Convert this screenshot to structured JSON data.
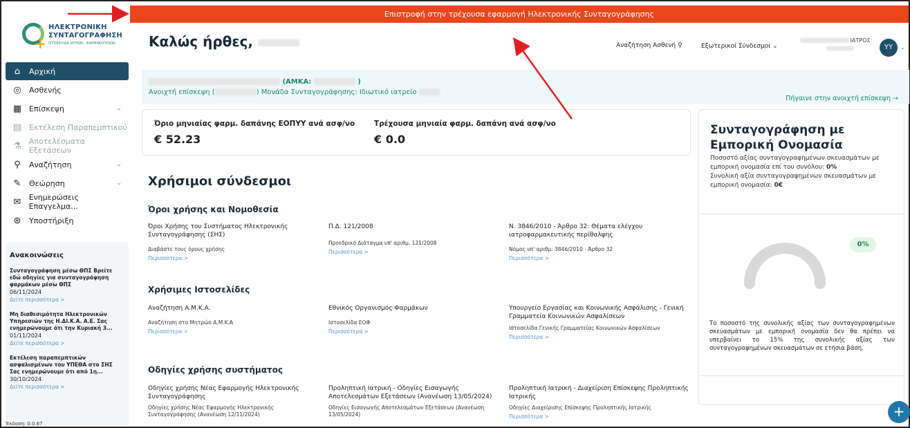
{
  "banner": {
    "text": "Επιστροφή στην τρέχουσα εφαρμογή Ηλεκτρονικής Συνταγογράφησης"
  },
  "logo": {
    "line1": "ΗΛΕΚΤΡΟΝΙΚΗ",
    "line2": "ΣΥΝΤΑΓΟΓΡΑΦΗΣΗ",
    "line3": "ΙΣΤΟΣΕΛΙΔΑ ΙΑΤΡΩΝ - ΦΑΡΜΑΚΟΠΟΙΩΝ"
  },
  "sidebar": {
    "items": [
      {
        "label": "Αρχική",
        "icon": "home-icon"
      },
      {
        "label": "Ασθενής",
        "icon": "user-icon"
      },
      {
        "label": "Επίσκεψη",
        "icon": "calendar-icon"
      },
      {
        "label": "Εκτέλεση Παραπεμπτικού",
        "icon": "document-icon"
      },
      {
        "label": "Αποτελέσματα Εξετάσεων",
        "icon": "flask-icon"
      },
      {
        "label": "Αναζήτηση",
        "icon": "search-icon"
      },
      {
        "label": "Θεώρηση",
        "icon": "pen-icon"
      },
      {
        "label": "Ενημερώσεις Επαγγελμα...",
        "icon": "mail-icon"
      },
      {
        "label": "Υποστήριξη",
        "icon": "support-icon"
      }
    ]
  },
  "announcements": {
    "title": "Ανακοινώσεις",
    "items": [
      {
        "head": "Συνταγογράφηση μέσω ΘΠΣ Βρείτε εδώ οδηγίες για συνταγογράφηση φαρμάκων μέσω ΘΠΣ",
        "date": "06/11/2024",
        "more": "Δείτε περισσότερα >"
      },
      {
        "head": "Μη διαθεσιμότητα Ηλεκτρονικών Υπηρεσιών της Η.ΔΙ.Κ.Α. Α.Ε. Σας ενημερώνουμε ότι την Κυριακή 3...",
        "date": "01/11/2024",
        "more": "Δείτε περισσότερα >"
      },
      {
        "head": "Εκτέλεση παραπεμπτικών ασφαλισμένων του ΥΠΕΘΑ στο ΣΗΣ Σας ενημερώνουμε ότι από 1η...",
        "date": "30/10/2024",
        "more": "Δείτε περισσότερα >"
      }
    ],
    "version": "Έκδοση: 0.0.67"
  },
  "header": {
    "greeting": "Καλώς ήρθες,",
    "search": "Αναζήτηση Ασθενή",
    "links": "Εξωτερικοί Σύνδεσμοι",
    "user_role": "ΙΑΤΡΟΣ",
    "avatar": "YY"
  },
  "patient": {
    "amka_label": "(ΑΜΚΑ:",
    "amka_close": ")",
    "visit_prefix": "Ανοιχτή επίσκεψη (",
    "visit_suffix": ")  Μονάδα Συνταγογράφησης: Ιδιωτικό ιατρείο",
    "go_link": "Πήγαινε στην ανοιχτή επίσκεψη"
  },
  "limits": {
    "limit_label": "Όριο μηνιαίας φαρμ. δαπάνης ΕΟΠΥΥ ανά ασφ/νο",
    "limit_value": "€ 52.23",
    "current_label": "Τρέχουσα μηνιαία φαρμ. δαπάνη ανά ασφ/νο",
    "current_value": "€ 0.0"
  },
  "useful": {
    "title": "Χρήσιμοι σύνδεσμοι",
    "sections": [
      {
        "title": "Όροι χρήσης και Νομοθεσία",
        "cells": [
          {
            "title": "Όροι Χρήσης του Συστήματος Ηλεκτρονικής Συνταγογράφησης (ΣΗΣ)",
            "sub": "Διαβάστε τους όρους χρήσης",
            "more": "Περισσότερα >"
          },
          {
            "title": "Π.Δ. 121/2008",
            "sub": "Προεδρικό Διάταγμα υπ' αριθμ. 121/2008",
            "more": "Περισσότερα >"
          },
          {
            "title": "Ν. 3846/2010 - Άρθρο 32: Θέματα ελέγχου ιατροφαρμακευτικής περίθαλψης",
            "sub": "Νόμος υπ' αριθμ. 3846/2010 - Άρθρο 32",
            "more": "Περισσότερα >"
          }
        ]
      },
      {
        "title": "Χρήσιμες Ιστοσελίδες",
        "cells": [
          {
            "title": "Αναζήτηση Α.Μ.Κ.Α.",
            "sub": "Αναζήτηση στο Μητρώο Α.Μ.Κ.Α",
            "more": "Περισσότερα >"
          },
          {
            "title": "Εθνικός Οργανισμός Φαρμάκων",
            "sub": "Ιστοσελίδα ΕΟΦ",
            "more": "Περισσότερα >"
          },
          {
            "title": "Υπουργείο Εργασίας και Κοινωνικής Ασφάλισης - Γενική Γραμματεία Κοινωνικών Ασφαλίσεων",
            "sub": "Ιστοσελίδα Γενικής Γραμματείας Κοινωνικών Ασφαλίσεων",
            "more": "Περισσότερα >"
          }
        ]
      },
      {
        "title": "Οδηγίες χρήσης συστήματος",
        "cells": [
          {
            "title": "Οδηγίες χρήσης Νέας Εφαρμογής Ηλεκτρονικής Συνταγογράφησης",
            "sub": "Οδηγίες χρήσης Νέας Εφαρμογής Ηλεκτρονικής Συνταγογράφησης (Ανανέωση 12/11/2024)",
            "more": ""
          },
          {
            "title": "Προληπτική Ιατρική - Οδηγίες Εισαγωγής Αποτελεσμάτων Εξετάσεων (Ανανέωση 13/05/2024)",
            "sub": "Οδηγίες Εισαγωγής Αποτελεσμάτων Εξετάσεων (Ανανέωση 13/05/2024)",
            "more": ""
          },
          {
            "title": "Προληπτική Ιατρική - Διαχείριση Επίσκεψης Προληπτικής Ιατρικής",
            "sub": "Οδηγίες Διαχείρισης Επίσκεψης Προληπτικής Ιατρικής",
            "more": "Περισσότερα >"
          }
        ]
      }
    ]
  },
  "commercial": {
    "title": "Συνταγογράφηση με Εμπορική Ονομασία",
    "line1": "Ποσοστό αξίας συνταγογραφημένων σκευασμάτων με εμπορική ονομασία επί του συνόλου:",
    "line1_value": "0%",
    "line2": "Συνολική αξία συνταγογραφημένων σκευασμάτων με εμπορική ονομασία:",
    "line2_value": "0€",
    "gauge_label": "0%",
    "gauge_percent": 0,
    "note": "Το ποσοστό της συνολικής αξίας των συνταγογραφημένων σκευασμάτων με εμπορική ονομασία δεν θα πρέπει να υπερβαίνει το 15% της συνολικής αξίας των συνταγογραφημένων σκευασμάτων σε ετήσια βάση."
  },
  "colors": {
    "banner": "#e8471b",
    "accent": "#1f4f68",
    "green": "#1c8a6a",
    "link": "#5b93c7"
  }
}
